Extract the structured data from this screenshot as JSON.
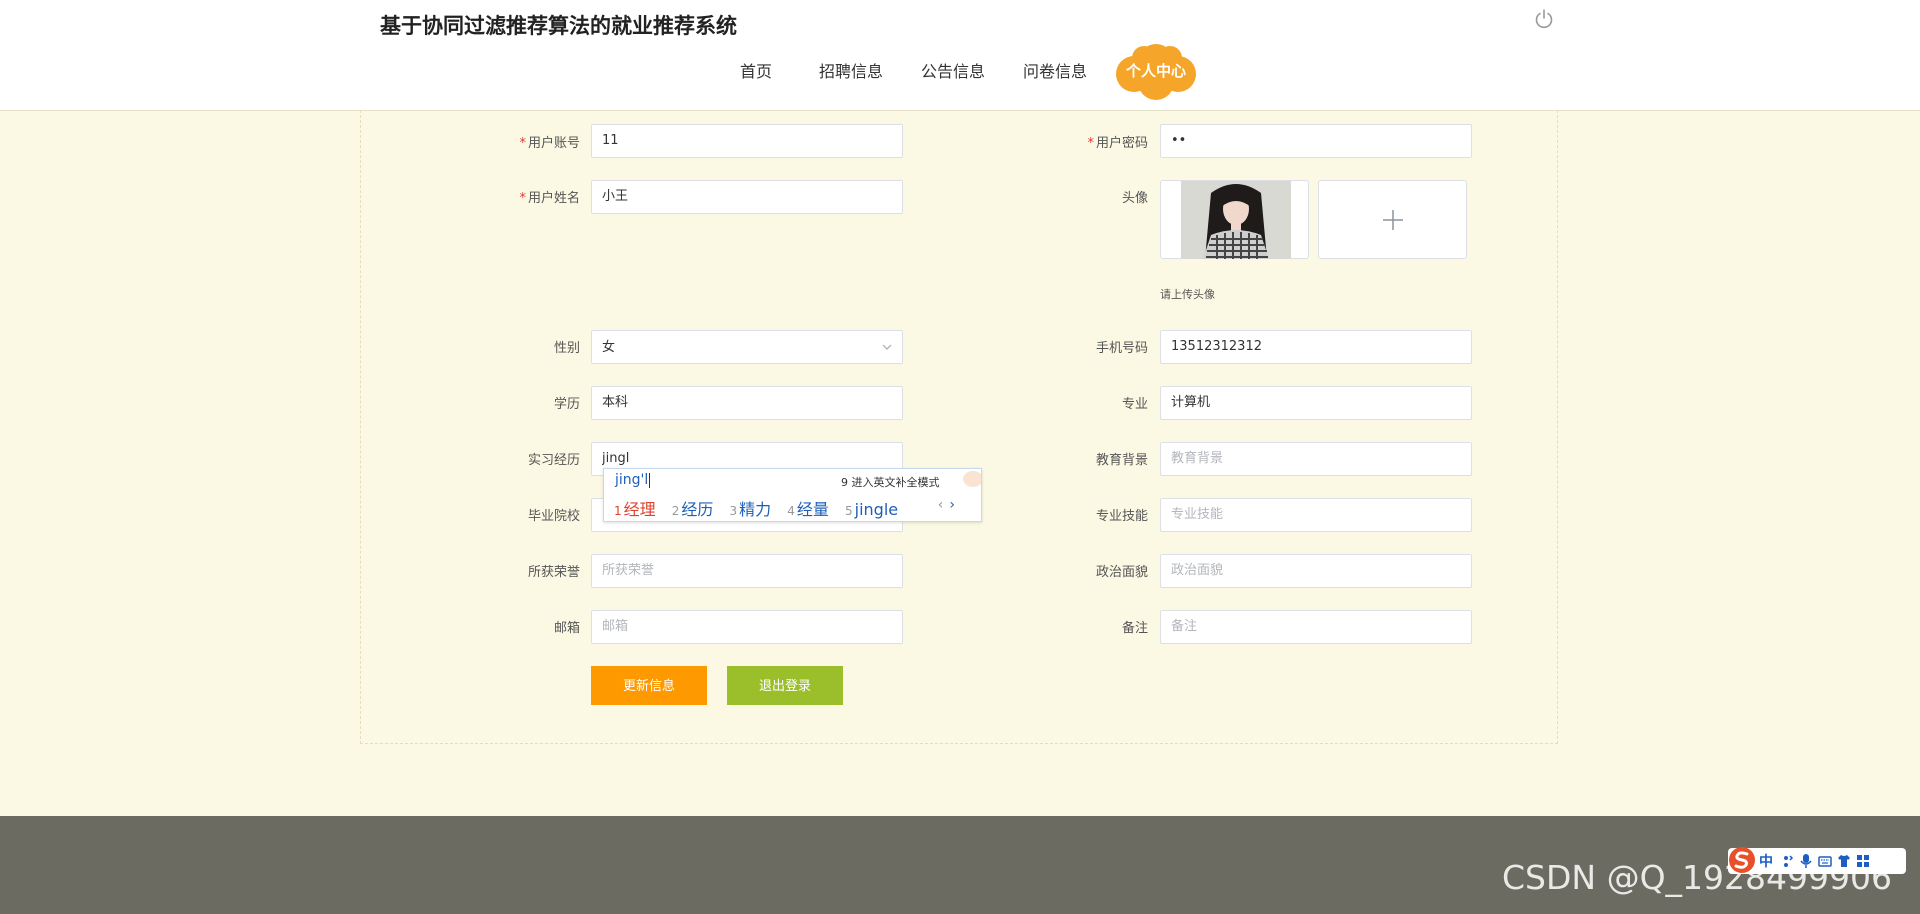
{
  "header": {
    "site_title": "基于协同过滤推荐算法的就业推荐系统",
    "nav": [
      "首页",
      "招聘信息",
      "公告信息",
      "问卷信息"
    ],
    "active_nav": "个人中心"
  },
  "form": {
    "account": {
      "label": "用户账号",
      "value": "11"
    },
    "password": {
      "label": "用户密码",
      "value": "••"
    },
    "name": {
      "label": "用户姓名",
      "value": "小王"
    },
    "avatar": {
      "label": "头像",
      "hint": "请上传头像"
    },
    "gender": {
      "label": "性别",
      "value": "女"
    },
    "phone": {
      "label": "手机号码",
      "value": "13512312312"
    },
    "education": {
      "label": "学历",
      "value": "本科"
    },
    "major": {
      "label": "专业",
      "value": "计算机"
    },
    "internship": {
      "label": "实习经历",
      "value": "jingl"
    },
    "edu_background": {
      "label": "教育背景",
      "placeholder": "教育背景"
    },
    "school": {
      "label": "毕业院校",
      "placeholder": ""
    },
    "skills": {
      "label": "专业技能",
      "placeholder": "专业技能"
    },
    "honors": {
      "label": "所获荣誉",
      "placeholder": "所获荣誉"
    },
    "political": {
      "label": "政治面貌",
      "placeholder": "政治面貌"
    },
    "email": {
      "label": "邮箱",
      "placeholder": "邮箱"
    },
    "remark": {
      "label": "备注",
      "placeholder": "备注"
    },
    "update_button": "更新信息",
    "logout_button": "退出登录"
  },
  "ime": {
    "composition": "jing'l",
    "hint": "9 进入英文补全模式",
    "candidates": [
      {
        "num": "1",
        "text": "经理"
      },
      {
        "num": "2",
        "text": "经历"
      },
      {
        "num": "3",
        "text": "精力"
      },
      {
        "num": "4",
        "text": "经量"
      },
      {
        "num": "5",
        "text": "jingle"
      }
    ],
    "prev": "‹",
    "next": "›"
  },
  "ime_toolbar": {
    "mode": "中"
  },
  "watermark": "CSDN @Q_1928499906",
  "colors": {
    "page_bg": "#fbf9e4",
    "update_button": "#ff9900",
    "logout_button": "#9bbf2a",
    "active_nav_cloud": "#f4a52a",
    "footer": "#6b6b62",
    "required": "#e4393c"
  }
}
